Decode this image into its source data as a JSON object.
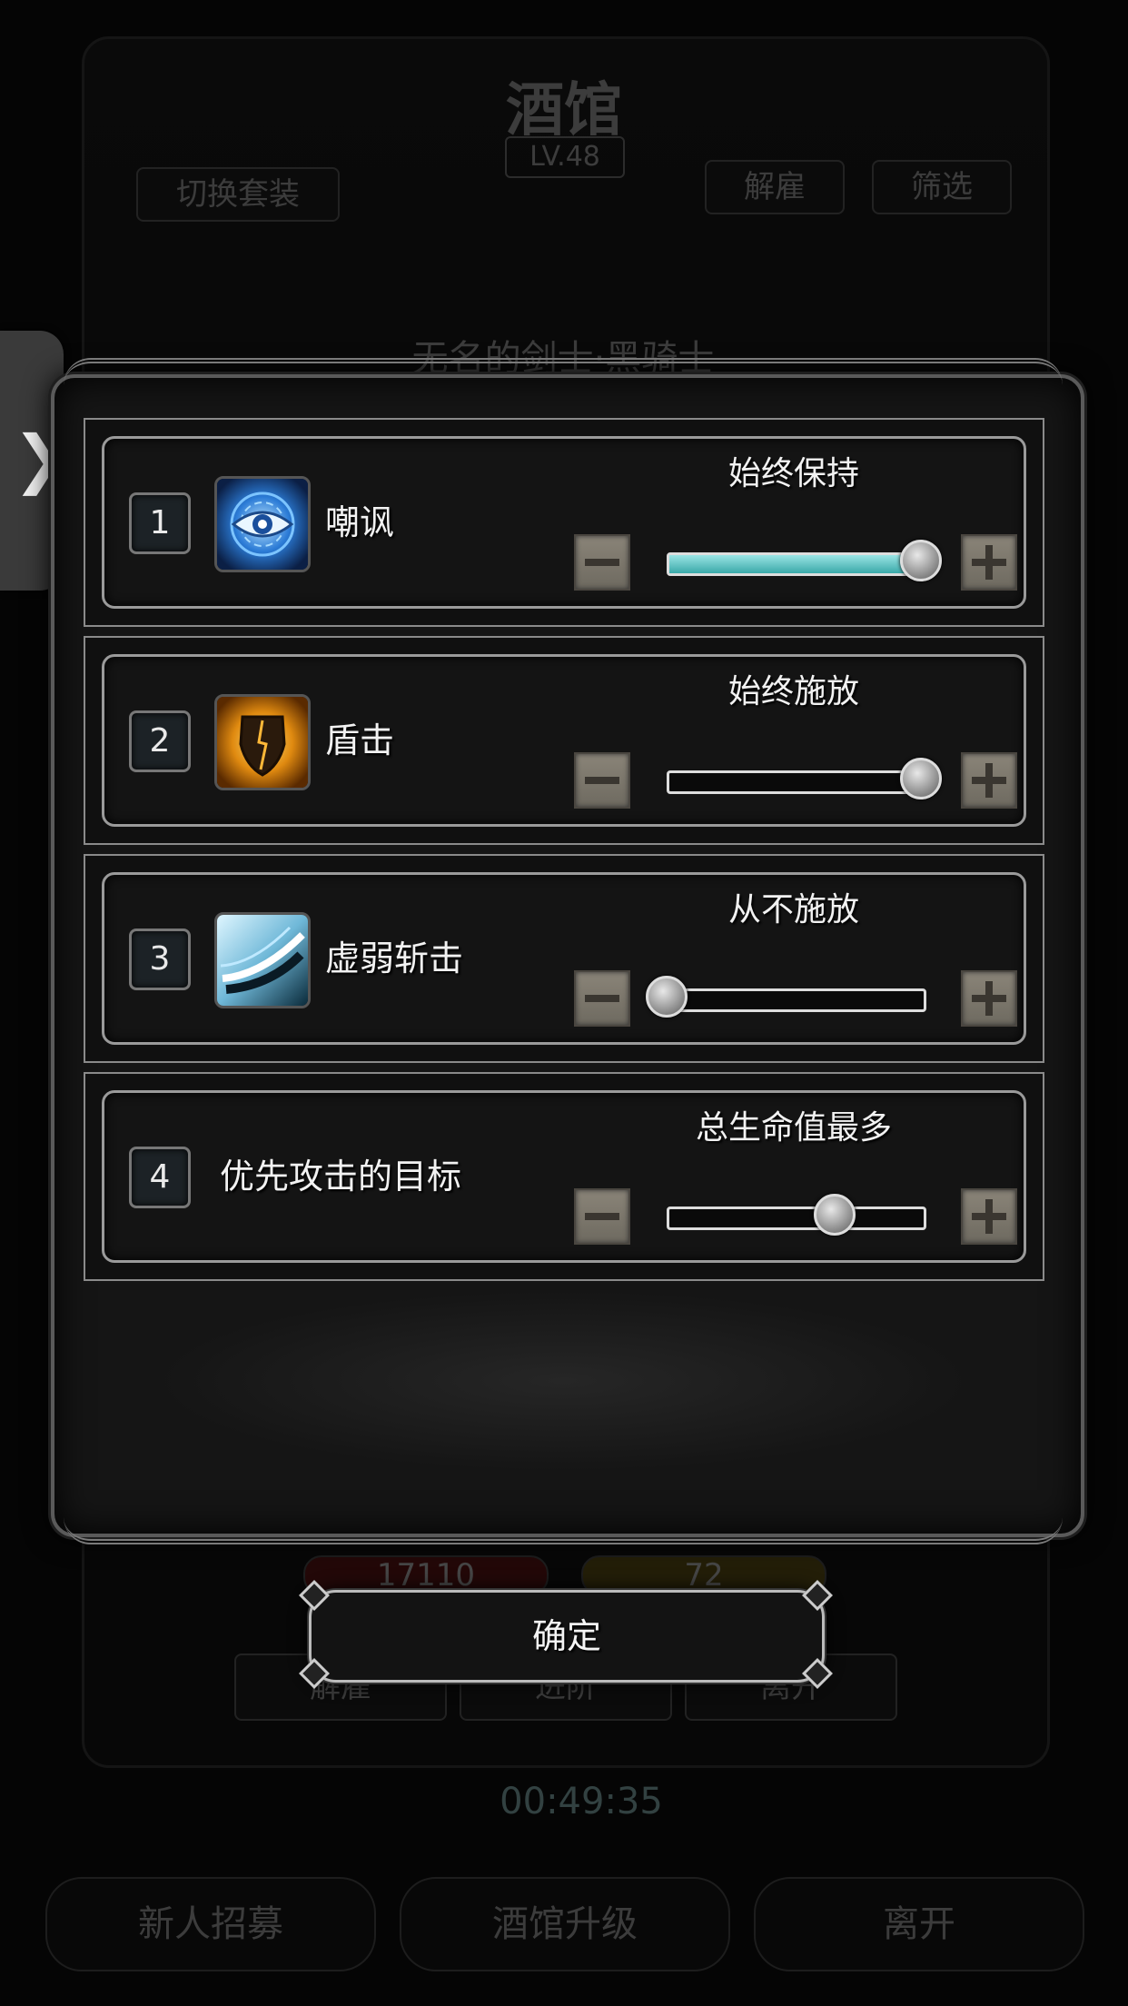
{
  "background": {
    "title": "酒馆",
    "level": "LV.48",
    "switch_outfit": "切换套装",
    "dismiss_top": "解雇",
    "filter": "筛选",
    "hero_name": "无名的剑士·黑骑士",
    "hp": "17110",
    "energy": "72",
    "dismiss": "解雇",
    "advance": "进阶",
    "leave_small": "离开",
    "timer": "00:49:35",
    "recruit": "新人招募",
    "upgrade": "酒馆升级",
    "leave": "离开"
  },
  "side_tab": {
    "icon": "chevron-right-icon",
    "glyph": "❯"
  },
  "settings": [
    {
      "number": "1",
      "label": "嘲讽",
      "icon": "taunt-eye-icon",
      "value": "始终保持",
      "level": 1.0,
      "highlight": true
    },
    {
      "number": "2",
      "label": "盾击",
      "icon": "shield-bash-icon",
      "value": "始终施放",
      "level": 1.0,
      "highlight": false
    },
    {
      "number": "3",
      "label": "虚弱斩击",
      "icon": "weaken-slash-icon",
      "value": "从不施放",
      "level": 0.0,
      "highlight": false
    },
    {
      "number": "4",
      "label": "优先攻击的目标",
      "icon": null,
      "value": "总生命值最多",
      "level": 0.66,
      "highlight": false
    }
  ],
  "confirm_label": "确定",
  "colors": {
    "slider_fill": "#5ccfcf",
    "button_face": "#7d786d"
  }
}
